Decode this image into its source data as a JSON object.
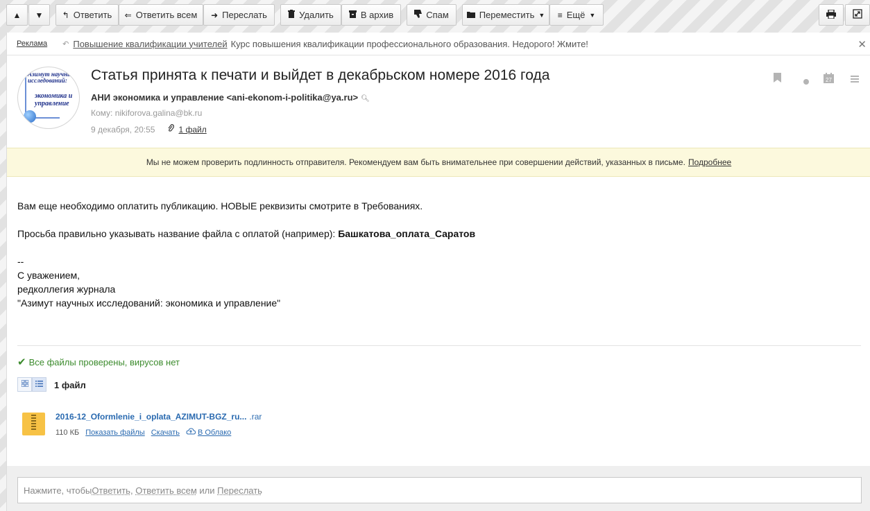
{
  "toolbar": {
    "up_icon": "▲",
    "down_icon": "▼",
    "reply_label": "Ответить",
    "reply_all_label": "Ответить всем",
    "forward_label": "Переслать",
    "delete_label": "Удалить",
    "archive_label": "В архив",
    "spam_label": "Спам",
    "move_label": "Переместить",
    "more_label": "Ещё"
  },
  "ad": {
    "label": "Реклама",
    "link_text": "Повышение квалификации учителей",
    "text": "Курс повышения квалификации профессионального образования. Недорого! Жмите!"
  },
  "message": {
    "avatar": {
      "top_text": "Азимут научных исследований:",
      "bottom_text": "экономика и управление"
    },
    "subject": "Статья принята к печати и выйдет в декабрьском номере 2016 года",
    "sender": "АНИ экономика и управление <ani-ekonom-i-politika@ya.ru>",
    "to": "Кому: nikiforova.galina@bk.ru",
    "date": "9 декабря, 20:55",
    "files_link": "1 файл",
    "calendar_day": "27"
  },
  "warning": {
    "text": "Мы не можем проверить подлинность отправителя. Рекомендуем вам быть внимательнее при совершении действий, указанных в письме.",
    "more_link": "Подробнее"
  },
  "body": {
    "line1": "Вам еще необходимо оплатить публикацию. НОВЫЕ реквизиты смотрите в Требованиях.",
    "line2_prefix": "Просьба правильно указывать название файла с оплатой (например): ",
    "line2_bold": "Башкатова_оплата_Саратов",
    "sig_dash": "--",
    "sig1": "С уважением,",
    "sig2": "редколлегия журнала",
    "sig3": "\"Азимут научных исследований: экономика и управление\""
  },
  "attachments": {
    "virus_status": "Все файлы проверены, вирусов нет",
    "count_label": "1 файл",
    "files": [
      {
        "name": "2016-12_Oformlenie_i_oplata_AZIMUT-BGZ_ru...",
        "ext": ".rar",
        "size": "110 КБ",
        "show_label": "Показать файлы",
        "download_label": "Скачать",
        "cloud_label": "В Облако"
      }
    ]
  },
  "reply": {
    "prefix": "Нажмите, чтобы ",
    "reply": "Ответить",
    "sep1": ", ",
    "reply_all": "Ответить всем",
    "sep2": " или ",
    "forward": "Переслать"
  }
}
